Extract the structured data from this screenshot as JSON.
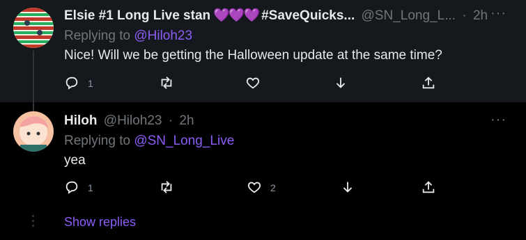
{
  "tweets": [
    {
      "name": "Elsie #1 Long Live stan",
      "hearts": "💜💜💜",
      "tag": "#SaveQuicks...",
      "handle": "@SN_Long_L...",
      "sep": "·",
      "time": "2h",
      "more": "···",
      "replying_prefix": "Replying to",
      "replying_mention": "@Hiloh23",
      "text": "Nice! Will we be getting the Halloween update at the same time?",
      "reply_count": "1",
      "retweet_count": "",
      "like_count": ""
    },
    {
      "name": "Hiloh",
      "handle": "@Hiloh23",
      "sep": "·",
      "time": "2h",
      "more": "···",
      "replying_prefix": "Replying to",
      "replying_mention": "@SN_Long_Live",
      "text": "yea",
      "reply_count": "1",
      "retweet_count": "",
      "like_count": "2"
    }
  ],
  "show_replies": "Show replies",
  "colors": {
    "accent": "#8b5cf6",
    "muted": "#71767b",
    "highlight_bg": "#15181c"
  }
}
